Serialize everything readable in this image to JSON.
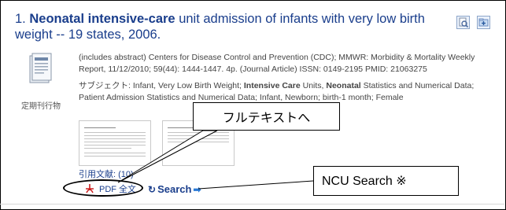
{
  "result": {
    "number": "1.",
    "title_bold_1": "Neonatal intensive-care",
    "title_rest_1": " unit admission of infants with very low birth weight -- 19 states, 2006.",
    "citation": "(includes abstract) Centers for Disease Control and Prevention (CDC); MMWR: Morbidity & Mortality Weekly Report, 11/12/2010; 59(44): 1444-1447. 4p. (Journal Article) ISSN: 0149-2195 PMID: 21063275",
    "subjects_label": "サブジェクト:",
    "subjects_part1": " Infant, Very Low Birth Weight; ",
    "subjects_bold1": "Intensive Care",
    "subjects_part2": " Units, ",
    "subjects_bold2": "Neonatal",
    "subjects_part3": " Statistics and Numerical Data; Patient Admission Statistics and Numerical Data; Infant, Newborn; birth-1 month; Female",
    "publication_type": "定期刊行物",
    "cited_references": "引用文献: (10)",
    "pdf_label": "PDF 全文",
    "search_label": "Search",
    "icons": [
      "preview-icon",
      "folder-add-icon",
      "periodical-icon",
      "pdf-icon",
      "search-arrow-icon"
    ]
  },
  "annotations": {
    "fulltext_callout": "フルテキストへ",
    "ncu_callout": "NCU Search ※"
  },
  "colors": {
    "link": "#1a3e8c",
    "pdf_red": "#cc1f1f",
    "search_arrow": "#2a7ad6"
  }
}
